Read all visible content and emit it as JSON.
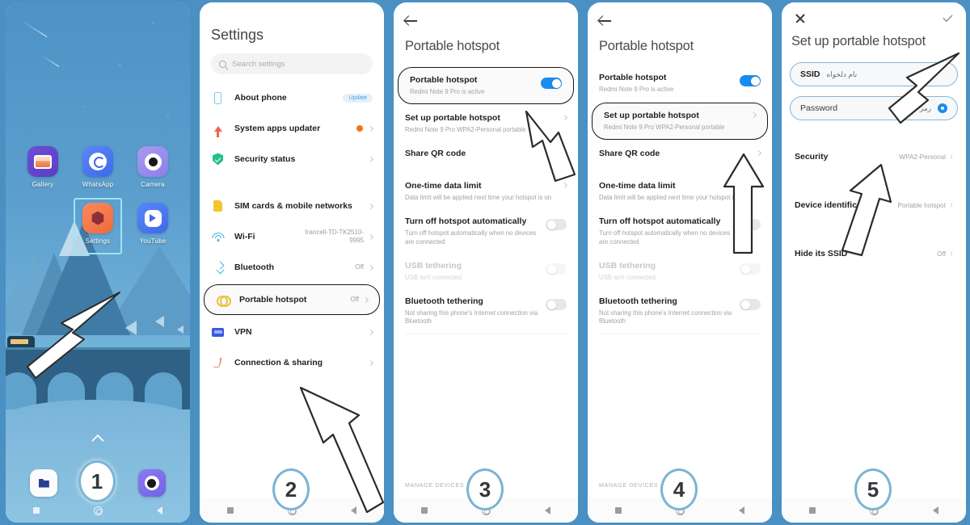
{
  "theme": {
    "frame_blue": "#4b90c2",
    "accent_blue": "#1a8cf0",
    "badge_ring": "#7cb4d4",
    "highlight_outline": "#151515"
  },
  "panels": [
    {
      "step": "1",
      "name": "home-screen",
      "apps": [
        {
          "label": "Gallery",
          "icon": "gallery-icon",
          "selected": false
        },
        {
          "label": "WhatsApp",
          "icon": "whatsapp-icon",
          "selected": false
        },
        {
          "label": "Camera",
          "icon": "camera-icon",
          "selected": false
        },
        {
          "label": "Settings",
          "icon": "settings-icon",
          "selected": true
        },
        {
          "label": "YouTube",
          "icon": "youtube-icon",
          "selected": false
        }
      ],
      "dock": [
        {
          "icon": "files-icon"
        },
        {
          "icon": "step-badge-1"
        },
        {
          "icon": "camera-dock-icon"
        }
      ]
    },
    {
      "step": "2",
      "name": "settings-list",
      "title": "Settings",
      "search_placeholder": "Search settings",
      "items": [
        {
          "label": "About phone",
          "value": "",
          "icon": "phone-icon",
          "badge": "Update",
          "chevron": false,
          "highlight": false
        },
        {
          "label": "System apps updater",
          "value": "",
          "icon": "up-arrow-icon",
          "dot": true,
          "chevron": true,
          "highlight": false
        },
        {
          "label": "Security status",
          "value": "",
          "icon": "shield-icon",
          "chevron": true,
          "highlight": false
        },
        {
          "label": "SIM cards & mobile networks",
          "value": "",
          "icon": "sim-card-icon",
          "chevron": true,
          "highlight": false
        },
        {
          "label": "Wi-Fi",
          "value": "Irancell-TD-TK2510-9995",
          "icon": "wifi-icon",
          "chevron": true,
          "highlight": false
        },
        {
          "label": "Bluetooth",
          "value": "Off",
          "icon": "bluetooth-icon",
          "chevron": true,
          "highlight": false
        },
        {
          "label": "Portable hotspot",
          "value": "Off",
          "icon": "hotspot-icon",
          "chevron": true,
          "highlight": true
        },
        {
          "label": "VPN",
          "value": "",
          "icon": "vpn-icon",
          "chevron": true,
          "highlight": false
        },
        {
          "label": "Connection & sharing",
          "value": "",
          "icon": "connection-icon",
          "chevron": true,
          "highlight": false
        }
      ]
    },
    {
      "step": "3",
      "name": "portable-hotspot-page",
      "title": "Portable hotspot",
      "footer": "MANAGE DEVICES",
      "rows": [
        {
          "title": "Portable hotspot",
          "sub": "Redmi Note 9 Pro is active",
          "control": "toggle-on",
          "highlight": true,
          "dim": false
        },
        {
          "title": "Set up portable hotspot",
          "sub": "Redmi Note 9 Pro WPA2-Personal portable",
          "control": "chevron",
          "highlight": false,
          "dim": false
        },
        {
          "title": "Share QR code",
          "sub": "",
          "control": "chevron",
          "highlight": false,
          "dim": false
        },
        {
          "title": "One-time data limit",
          "sub": "Data limit will be applied next time your hotspot is on",
          "control": "chevron",
          "highlight": false,
          "dim": false
        },
        {
          "title": "Turn off hotspot automatically",
          "sub": "Turn off hotspot automatically when no devices are connected",
          "control": "toggle-off",
          "highlight": false,
          "dim": false
        },
        {
          "title": "USB tethering",
          "sub": "USB isn't connected",
          "control": "toggle-faint",
          "highlight": false,
          "dim": true
        },
        {
          "title": "Bluetooth tethering",
          "sub": "Not sharing this phone's Internet connection via Bluetooth",
          "control": "toggle-off",
          "highlight": false,
          "dim": false
        }
      ]
    },
    {
      "step": "4",
      "name": "portable-hotspot-page-setup-highlighted",
      "title": "Portable hotspot",
      "footer": "MANAGE DEVICES",
      "rows": [
        {
          "title": "Portable hotspot",
          "sub": "Redmi Note 9 Pro is active",
          "control": "toggle-on",
          "highlight": false,
          "dim": false
        },
        {
          "title": "Set up portable hotspot",
          "sub": "Redmi Note 9 Pro WPA2-Personal portable",
          "control": "chevron",
          "highlight": true,
          "dim": false
        },
        {
          "title": "Share QR code",
          "sub": "",
          "control": "chevron",
          "highlight": false,
          "dim": false
        },
        {
          "title": "One-time data limit",
          "sub": "Data limit will be applied next time your hotspot is on",
          "control": "chevron",
          "highlight": false,
          "dim": false
        },
        {
          "title": "Turn off hotspot automatically",
          "sub": "Turn off hotspot automatically when no devices are connected",
          "control": "toggle-off",
          "highlight": false,
          "dim": false
        },
        {
          "title": "USB tethering",
          "sub": "USB isn't connected",
          "control": "toggle-faint",
          "highlight": false,
          "dim": true
        },
        {
          "title": "Bluetooth tethering",
          "sub": "Not sharing this phone's Internet connection via Bluetooth",
          "control": "toggle-off",
          "highlight": false,
          "dim": false
        }
      ]
    },
    {
      "step": "5",
      "name": "setup-portable-hotspot-page",
      "title": "Set up portable hotspot",
      "close_icon": "close-icon",
      "confirm_icon": "check-icon",
      "fields": [
        {
          "label": "SSID",
          "value": "نام دلخواه",
          "eye": false,
          "highlight": true
        },
        {
          "label": "Password",
          "value": "رمز عبور",
          "eye": true,
          "highlight": true
        }
      ],
      "options": [
        {
          "label": "Security",
          "value": "WPA2-Personal",
          "stepper": true
        },
        {
          "label": "Device identification",
          "value": "Portable hotspot",
          "stepper": true
        },
        {
          "label": "Hide its SSID",
          "value": "Off",
          "stepper": true
        }
      ]
    }
  ]
}
